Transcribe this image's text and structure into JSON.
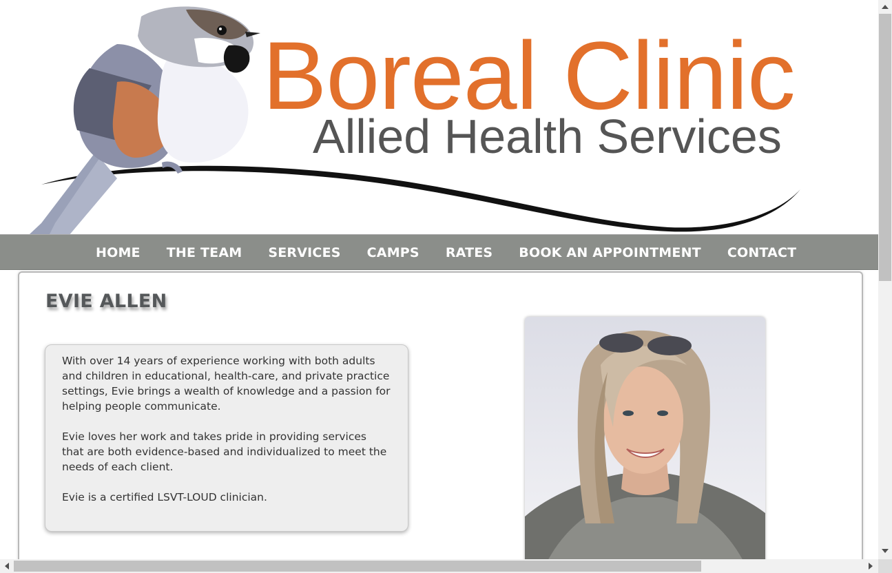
{
  "header": {
    "brand_title": "Boreal Clinic",
    "brand_subtitle": "Allied Health Services",
    "logo_icon": "chickadee-bird-icon"
  },
  "nav": {
    "items": [
      {
        "label": "HOME"
      },
      {
        "label": "THE TEAM"
      },
      {
        "label": "SERVICES"
      },
      {
        "label": "CAMPS"
      },
      {
        "label": "RATES"
      },
      {
        "label": "BOOK AN APPOINTMENT"
      },
      {
        "label": "CONTACT"
      }
    ]
  },
  "profile": {
    "name": "EVIE ALLEN",
    "bio": [
      "With over 14 years of experience working with both adults and children in educational, health-care, and private practice settings, Evie brings a wealth of knowledge and a passion for helping people communicate.",
      "Evie loves her work and takes pride in providing services that are both evidence-based and individualized to meet the needs of each client.",
      "Evie is a certified LSVT-LOUD clinician."
    ],
    "photo_icon": "portrait-photo"
  },
  "colors": {
    "brand_orange": "#e2702b",
    "subtitle_gray": "#555555",
    "nav_bg": "#8b8e8a",
    "bio_box_bg": "#eeeeee"
  }
}
